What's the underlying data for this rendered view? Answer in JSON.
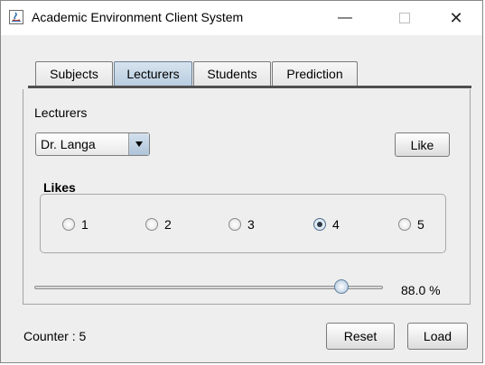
{
  "window": {
    "title": "Academic Environment Client System",
    "minimize": "—",
    "close": "✕"
  },
  "tabs": [
    {
      "label": "Subjects"
    },
    {
      "label": "Lecturers",
      "selected": true
    },
    {
      "label": "Students"
    },
    {
      "label": "Prediction"
    }
  ],
  "lecturers_panel": {
    "heading": "Lecturers",
    "lecturer_select": {
      "value": "Dr. Langa"
    },
    "like_button": "Like",
    "likes_group": {
      "title": "Likes",
      "options": [
        "1",
        "2",
        "3",
        "4",
        "5"
      ],
      "selected": "4"
    },
    "slider": {
      "value_fraction": 0.88,
      "readout": "88.0 %"
    }
  },
  "footer": {
    "counter_label": "Counter : 5",
    "reset_button": "Reset",
    "load_button": "Load"
  }
}
